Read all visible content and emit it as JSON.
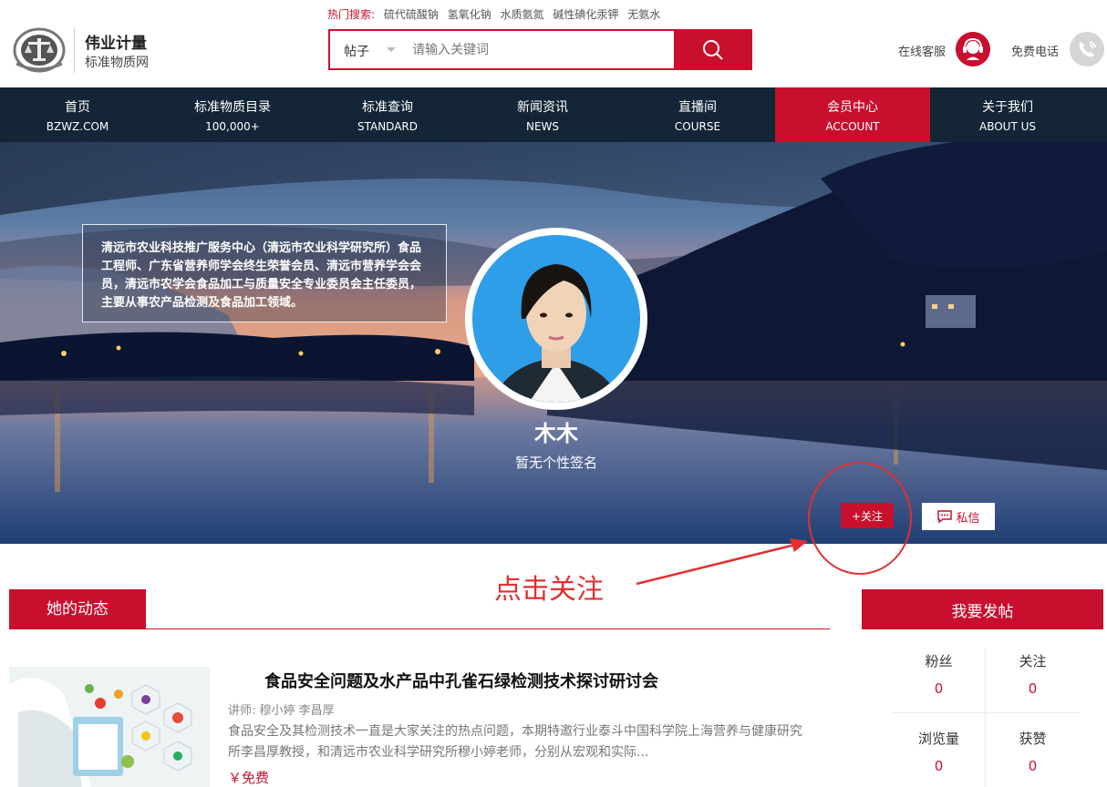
{
  "header": {
    "brand_name": "伟业计量",
    "brand_sub": "标准物质网",
    "hot_search_label": "热门搜索:",
    "hot_search_items": [
      "硫代硫酸钠",
      "氢氧化钠",
      "水质氨氮",
      "碱性碘化汞钾",
      "无氨水"
    ],
    "search_type": "帖子",
    "search_placeholder": "请输入关键词",
    "service_label": "在线客服",
    "phone_label": "免费电话"
  },
  "nav": {
    "items": [
      {
        "cn": "首页",
        "en": "BZWZ.COM"
      },
      {
        "cn": "标准物质目录",
        "en": "100,000+"
      },
      {
        "cn": "标准查询",
        "en": "STANDARD"
      },
      {
        "cn": "新闻资讯",
        "en": "NEWS"
      },
      {
        "cn": "直播间",
        "en": "COURSE"
      },
      {
        "cn": "会员中心",
        "en": "ACCOUNT"
      },
      {
        "cn": "关于我们",
        "en": "ABOUT US"
      }
    ],
    "active_index": 5
  },
  "profile": {
    "bio": "清远市农业科技推广服务中心（清远市农业科学研究所）食品工程师、广东省营养师学会终生荣誉会员、清远市营养学会会员，清远市农学会食品加工与质量安全专业委员会主任委员，主要从事农产品检测及食品加工领域。",
    "name": "木木",
    "signature": "暂无个性签名",
    "follow_label": "+关注",
    "message_label": "私信"
  },
  "annotation": {
    "text": "点击关注"
  },
  "feed": {
    "section_title": "她的动态",
    "posts": [
      {
        "title": "食品安全问题及水产品中孔雀石绿检测技术探讨研讨会",
        "lecturer": "讲师:   穆小婷 李昌厚",
        "description": "食品安全及其检测技术一直是大家关注的热点问题，本期特邀行业泰斗中国科学院上海营养与健康研究所李昌厚教授，和清远市农业科学研究所穆小婷老师，分别从宏观和实际...",
        "price": "￥免费"
      }
    ]
  },
  "sidebar": {
    "post_button": "我要发帖",
    "stats": [
      {
        "label": "粉丝",
        "value": "0"
      },
      {
        "label": "关注",
        "value": "0"
      },
      {
        "label": "浏览量",
        "value": "0"
      },
      {
        "label": "获赞",
        "value": "0"
      }
    ]
  },
  "colors": {
    "brand_red": "#c8102e",
    "nav_bg": "#132536",
    "annotation_red": "#e03030"
  }
}
